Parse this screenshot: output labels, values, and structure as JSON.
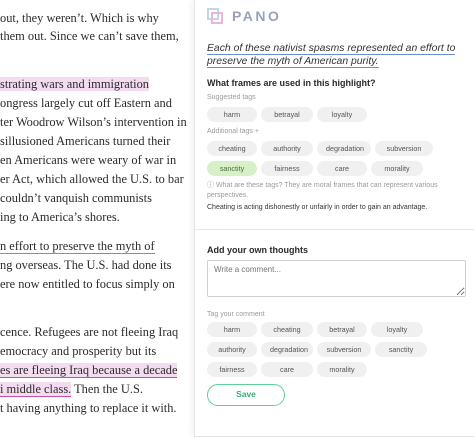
{
  "article": {
    "lines": [
      "out, they weren’t. Which is why",
      "them out. Since we can’t save them,",
      "strating wars and immigration",
      "ongress largely cut off Eastern and",
      "ter Woodrow Wilson’s intervention in",
      "sillusioned Americans turned their",
      "en Americans were weary of war in",
      "er Act, which allowed the U.S. to bar",
      " couldn’t vanquish communists",
      "ing to America’s shores.",
      "n effort to preserve the myth of",
      "ng overseas. The U.S. had done its",
      "ere now entitled to focus simply on",
      "cence. Refugees are not fleeing Iraq",
      "emocracy and prosperity but its",
      "es are fleeing Iraq because a decade",
      "i middle class.",
      " Then the U.S.",
      "t having anything to replace it with."
    ]
  },
  "panel": {
    "logo_text": "PANO",
    "quote": "Each of these nativist spasms represented an effort to preserve the myth of American purity.",
    "frames_question": "What frames are used in this highlight?",
    "suggested_label": "Suggested tags",
    "suggested_tags": [
      "harm",
      "betrayal",
      "loyalty"
    ],
    "additional_label": "Additional tags +",
    "additional_tags": [
      "cheating",
      "authority",
      "degradation",
      "subversion",
      "sanctity",
      "fairness",
      "care",
      "morality"
    ],
    "info_text": "What are these tags? They are moral frames that can represent various perspectives.",
    "definition": "Cheating is acting dishonestly or unfairly in order to gain an advantage.",
    "thoughts_title": "Add your own thoughts",
    "comment_placeholder": "Write a comment...",
    "tag_comment_label": "Tag your comment",
    "comment_tags": [
      "harm",
      "cheating",
      "betrayal",
      "loyalty",
      "authority",
      "degradation",
      "subversion",
      "sanctity",
      "fairness",
      "care",
      "morality"
    ],
    "save_label": "Save"
  },
  "colors": {
    "highlight": "#f4dcf0",
    "active_tag": "#d8f0c8",
    "save_accent": "#5fcf9b"
  }
}
